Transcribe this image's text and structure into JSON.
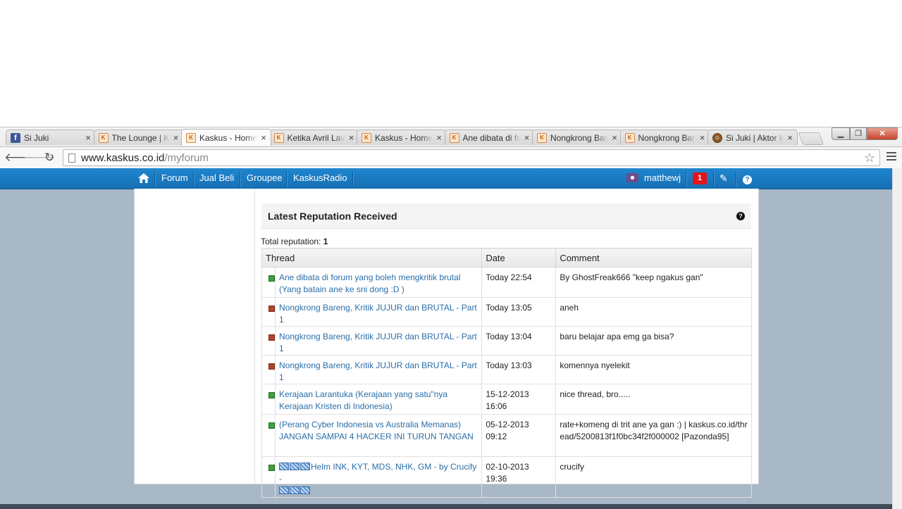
{
  "browser": {
    "tabs": [
      {
        "title": "Si Juki",
        "icon": "facebook-icon",
        "active": false
      },
      {
        "title": "The Lounge | Kaskus",
        "icon": "kaskus-icon",
        "active": false
      },
      {
        "title": "Kaskus - Home",
        "icon": "kaskus-icon",
        "active": true
      },
      {
        "title": "Ketika Avril Lavigne",
        "icon": "kaskus-icon",
        "active": false
      },
      {
        "title": "Kaskus - Home",
        "icon": "kaskus-icon",
        "active": false
      },
      {
        "title": "Ane dibata di forum",
        "icon": "kaskus-icon",
        "active": false
      },
      {
        "title": "Nongkrong Bareng",
        "icon": "kaskus-icon",
        "active": false
      },
      {
        "title": "Nongkrong Bareng",
        "icon": "kaskus-icon",
        "active": false
      },
      {
        "title": "Si Juki | Aktor Kaskus",
        "icon": "juki-icon",
        "active": false
      }
    ],
    "close_glyph": "×",
    "url_host": "www.kaskus.co.id",
    "url_path": "/myforum"
  },
  "nav": {
    "items": [
      "Forum",
      "Jual Beli",
      "Groupee",
      "KaskusRadio"
    ],
    "username": "matthewj",
    "notification_count": "1"
  },
  "reputation": {
    "title": "Latest Reputation Received",
    "total_label": "Total reputation:",
    "total_value": "1",
    "columns": {
      "thread": "Thread",
      "date": "Date",
      "comment": "Comment"
    },
    "rows": [
      {
        "type": "positive",
        "thread": "Ane dibata di forum yang boleh mengkritik brutal (Yang batain ane ke sni dong :D )",
        "date": "Today 22:54",
        "comment": "By GhostFreak666 \"keep ngakus gan\""
      },
      {
        "type": "negative",
        "thread": "Nongkrong Bareng, Kritik JUJUR dan BRUTAL - Part 1",
        "date": "Today 13:05",
        "comment": "aneh"
      },
      {
        "type": "negative",
        "thread": "Nongkrong Bareng, Kritik JUJUR dan BRUTAL - Part 1",
        "date": "Today 13:04",
        "comment": "baru belajar apa emg ga bisa?"
      },
      {
        "type": "negative",
        "thread": "Nongkrong Bareng, Kritik JUJUR dan BRUTAL - Part 1",
        "date": "Today 13:03",
        "comment": "komennya nyelekit"
      },
      {
        "type": "positive",
        "thread": "Kerajaan Larantuka (Kerajaan yang satu\"nya Kerajaan Kristen di Indonesia)",
        "date": "15-12-2013 16:06",
        "comment": "nice thread, bro....."
      },
      {
        "type": "positive",
        "thread": "(Perang Cyber Indonesia vs Australia Memanas) JANGAN SAMPAI 4 HACKER INI TURUN TANGAN",
        "date": "05-12-2013 09:12",
        "comment": "rate+komeng di trit ane ya gan :) | kaskus.co.id/thread/5200813f1f0bc34f2f000002 [Pazonda95]"
      },
      {
        "type": "positive",
        "thread": "Helm INK, KYT, MDS, NHK, GM - by Crucify -",
        "date": "02-10-2013 19:36",
        "comment": "crucify",
        "decorated": true
      }
    ]
  },
  "colors": {
    "positive": "#3aa33a",
    "negative": "#b5442a",
    "nav_blue": "#1a7cc4",
    "link": "#2a6ea8"
  }
}
